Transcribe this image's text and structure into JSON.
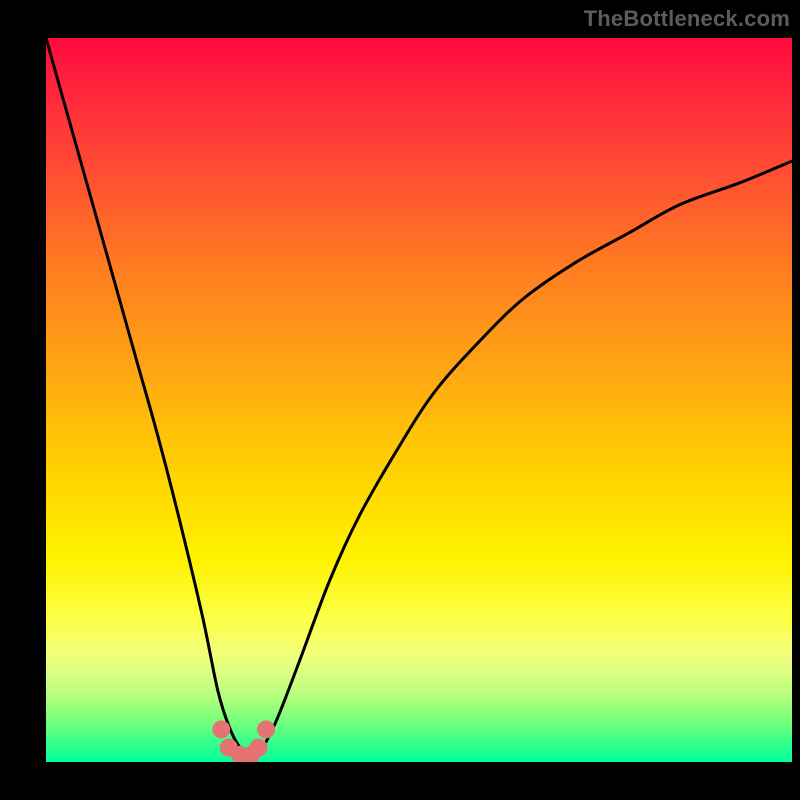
{
  "watermark": "TheBottleneck.com",
  "chart_data": {
    "type": "line",
    "title": "",
    "xlabel": "",
    "ylabel": "",
    "xlim": [
      0,
      100
    ],
    "ylim": [
      0,
      100
    ],
    "grid": false,
    "legend": false,
    "x": [
      0,
      3,
      6,
      9,
      12,
      15,
      18,
      21,
      23,
      24.5,
      26,
      27.5,
      29,
      31,
      34,
      38,
      42,
      47,
      52,
      58,
      64,
      71,
      78,
      85,
      93,
      100
    ],
    "y": [
      100,
      89,
      78,
      67,
      56,
      45,
      33,
      20,
      10,
      5,
      2,
      1,
      2,
      6,
      14,
      25,
      34,
      43,
      51,
      58,
      64,
      69,
      73,
      77,
      80,
      83
    ],
    "markers": {
      "x": [
        23.5,
        24.5,
        26,
        27.5,
        28.5,
        29.5
      ],
      "y": [
        4.5,
        2.0,
        1.0,
        1.0,
        2.0,
        4.5
      ]
    },
    "annotations": []
  }
}
